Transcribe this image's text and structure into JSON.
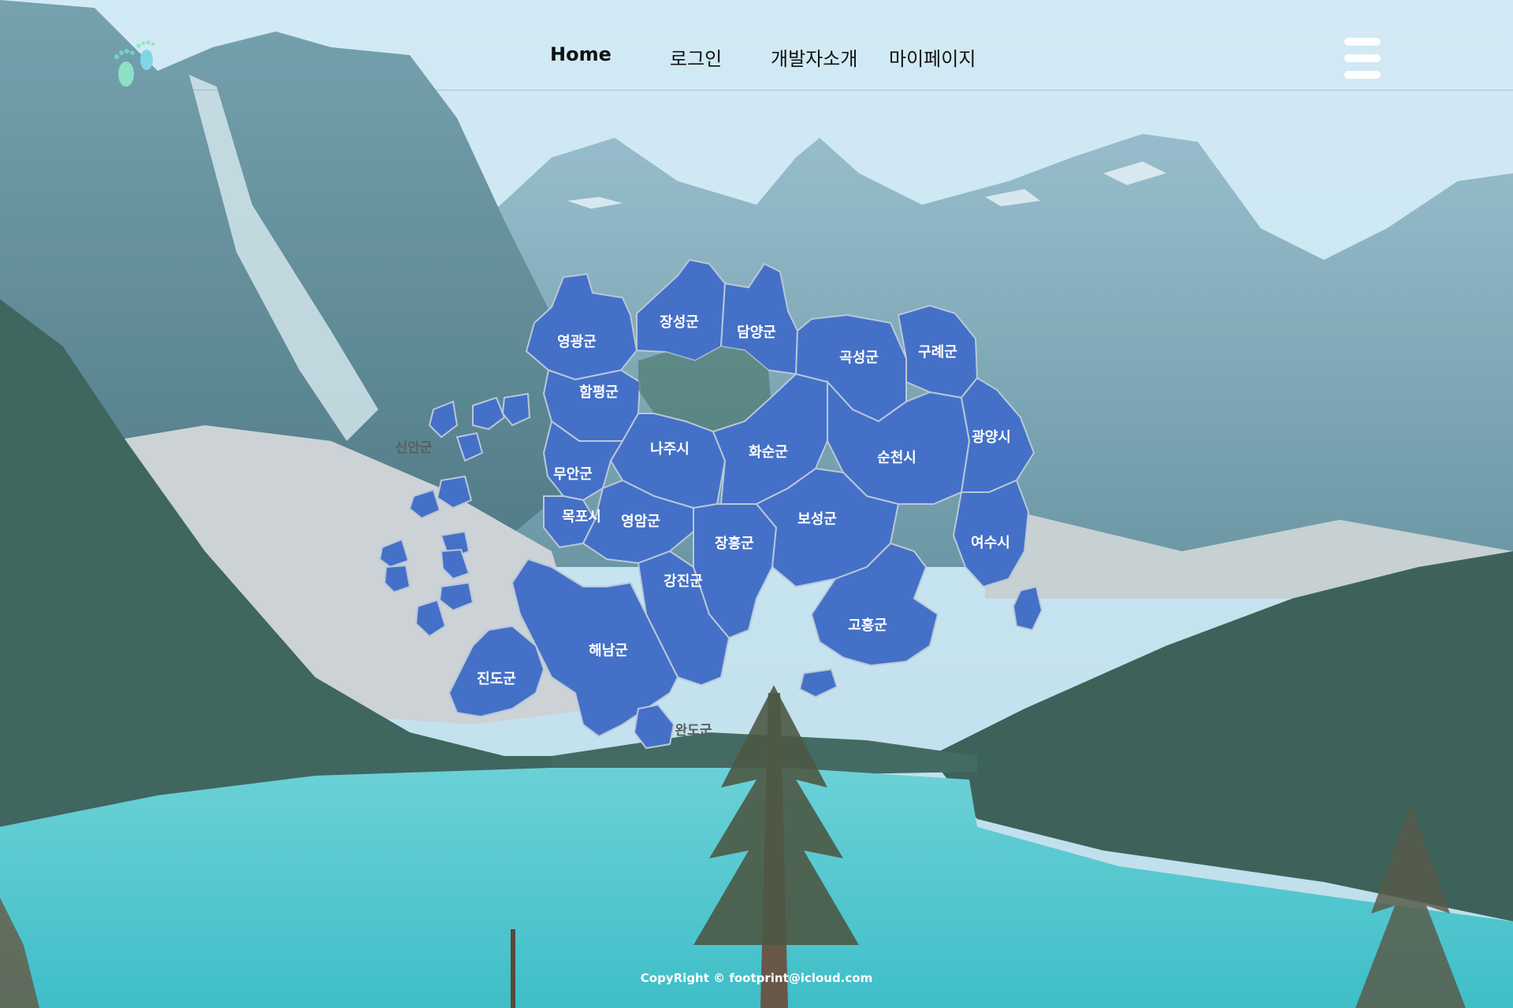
{
  "nav": {
    "home": "Home",
    "login": "로그인",
    "developer": "개발자소개",
    "mypage": "마이페이지"
  },
  "map": {
    "regions": {
      "yeonggwang": "영광군",
      "jangseong": "장성군",
      "damyang": "담양군",
      "gokseong": "곡성군",
      "gurye": "구례군",
      "hampyeong": "함평군",
      "naju": "나주시",
      "hwasun": "화순군",
      "suncheon": "순천시",
      "gwangyang": "광양시",
      "muan": "무안군",
      "mokpo": "목포시",
      "yeongam": "영암군",
      "jangheung": "장흥군",
      "boseong": "보성군",
      "yeosu": "여수시",
      "gangjin": "강진군",
      "goheung": "고흥군",
      "haenam": "해남군",
      "jindo": "진도군",
      "sinan": "신안군",
      "wando": "완도군"
    }
  },
  "footer": {
    "copyright": "CopyRight © footprint@icloud.com"
  },
  "colors": {
    "region_fill": "#4470c7",
    "lake": "#3fc3cc",
    "sky": "#cfe8f4"
  },
  "icons": {
    "logo": "footprint-icon",
    "menu": "hamburger-menu-icon"
  }
}
